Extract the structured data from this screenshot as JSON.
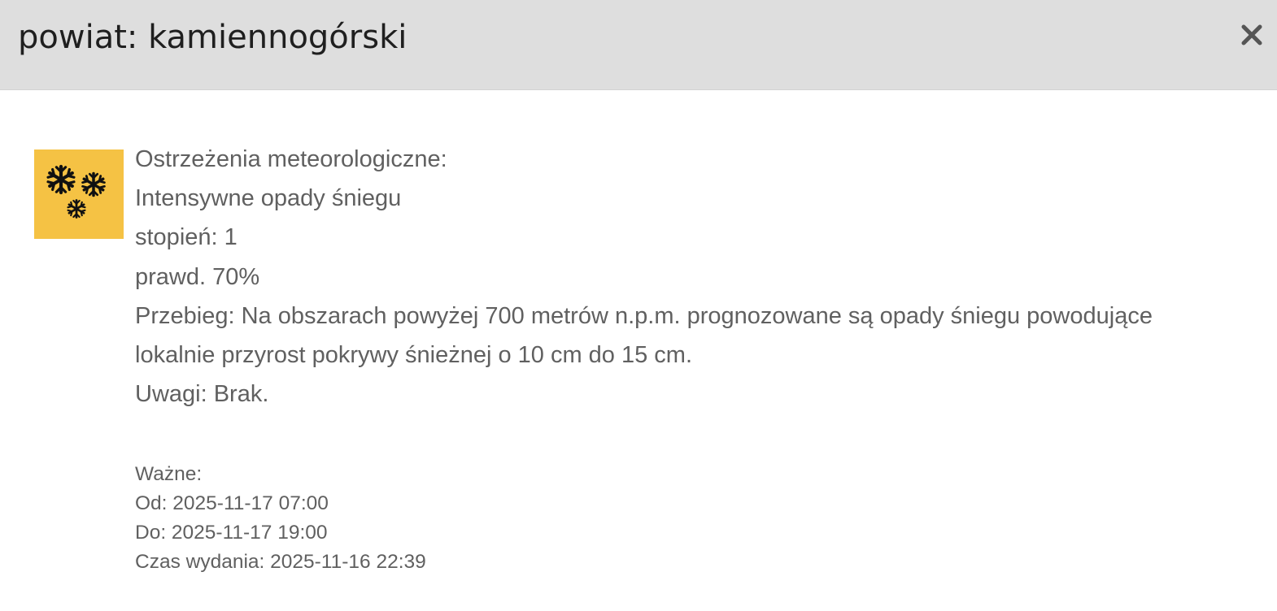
{
  "header": {
    "title": "powiat: kamiennogórski"
  },
  "warning": {
    "icon": "snowflakes-icon",
    "icon_color": "#f5c244",
    "heading": "Ostrzeżenia meteorologiczne:",
    "phenomenon": "Intensywne opady śniegu",
    "level": "stopień: 1",
    "probability": "prawd. 70%",
    "course_line1": "Przebieg: Na obszarach powyżej 700 metrów n.p.m. prognozowane są opady śniegu powodujące",
    "course_line2": "lokalnie przyrost pokrywy śnieżnej o 10 cm do 15 cm.",
    "remarks": "Uwagi: Brak."
  },
  "validity": {
    "label": "Ważne:",
    "from": "Od: 2025-11-17 07:00",
    "to": "Do: 2025-11-17 19:00",
    "issued": "Czas wydania: 2025-11-16 22:39"
  }
}
